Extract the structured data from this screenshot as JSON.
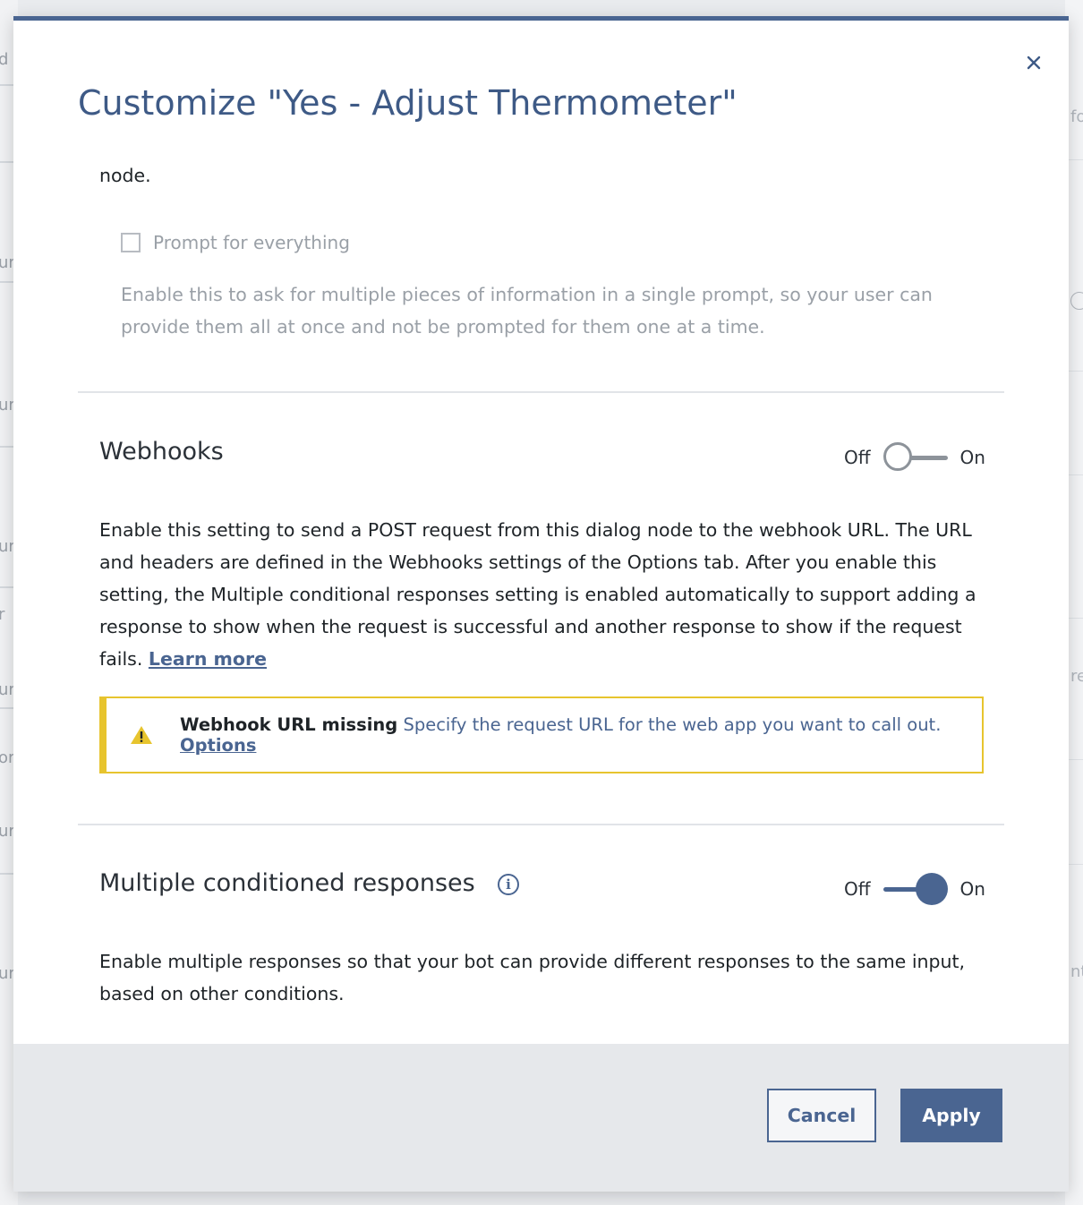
{
  "background": {
    "left_fragments": [
      "d",
      "ur",
      "ur",
      "ur",
      "r",
      "ur",
      "or",
      "ur",
      "ur"
    ],
    "right_fragments": [
      "fo",
      "re",
      "nt"
    ]
  },
  "modal": {
    "title": "Customize \"Yes - Adjust Thermometer\"",
    "close_icon": "close-icon",
    "intro_fragment": "node.",
    "prompt_checkbox": {
      "label": "Prompt for everything",
      "checked": false,
      "description": "Enable this to ask for multiple pieces of information in a single prompt, so your user can provide them all at once and not be prompted for them one at a time."
    },
    "webhooks": {
      "title": "Webhooks",
      "toggle_off_label": "Off",
      "toggle_on_label": "On",
      "toggle_state": "off",
      "description": "Enable this setting to send a POST request from this dialog node to the webhook URL. The URL and headers are defined in the Webhooks settings of the Options tab. After you enable this setting, the Multiple conditional responses setting is enabled automatically to support adding a response to show when the request is successful and another response to show if the request fails.",
      "learn_more": "Learn more",
      "warning": {
        "icon": "warning-icon",
        "title": "Webhook URL missing",
        "text": "Specify the request URL for the web app you want to call out.",
        "link": "Options"
      }
    },
    "multiple_responses": {
      "title": "Multiple conditioned responses",
      "info_icon": "info-icon",
      "toggle_off_label": "Off",
      "toggle_on_label": "On",
      "toggle_state": "on",
      "description": "Enable multiple responses so that your bot can provide different responses to the same input, based on other conditions."
    },
    "footer": {
      "cancel_label": "Cancel",
      "apply_label": "Apply"
    }
  },
  "colors": {
    "accent": "#4a6591",
    "warning": "#e7c42e",
    "text": "#1e2327",
    "muted": "#9aa0a7"
  }
}
